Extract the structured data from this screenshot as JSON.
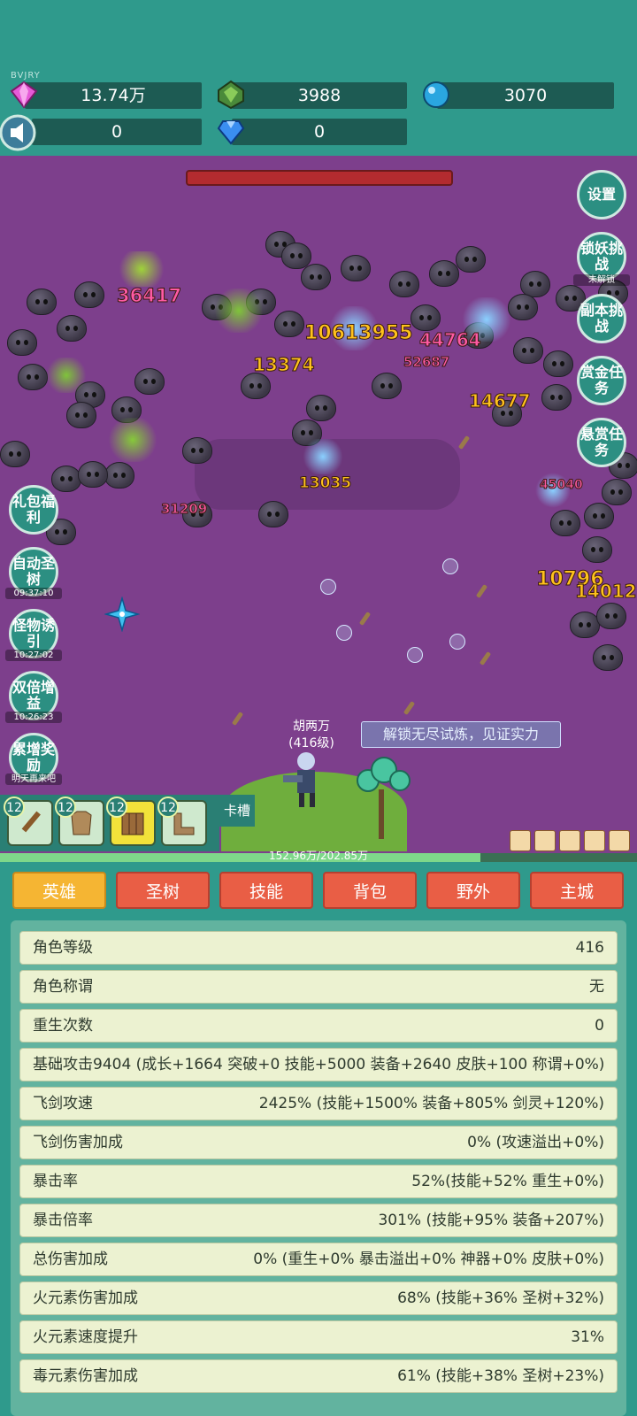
{
  "version_label": "BVJRY",
  "resources": {
    "gems": "13.74万",
    "green_crystal": "3988",
    "blue_orb": "3070",
    "book": "0",
    "diamond": "0"
  },
  "side_buttons_right": [
    {
      "label": "设置",
      "sub": ""
    },
    {
      "label": "锁妖挑战",
      "sub": "未解锁"
    },
    {
      "label": "副本挑战",
      "sub": ""
    },
    {
      "label": "赏金任务",
      "sub": ""
    },
    {
      "label": "悬赏任务",
      "sub": ""
    }
  ],
  "side_buttons_left": [
    {
      "label": "礼包福利",
      "sub": ""
    },
    {
      "label": "自动圣树",
      "sub": "09:37:10"
    },
    {
      "label": "怪物诱引",
      "sub": "10:27:02"
    },
    {
      "label": "双倍增益",
      "sub": "10:26:23"
    },
    {
      "label": "累增奖励",
      "sub": "明天再来吧"
    }
  ],
  "damage_numbers": {
    "big_yellow": [
      "10613955",
      "13374",
      "14677",
      "13035",
      "10796",
      "14012"
    ],
    "big_pink": [
      "36417",
      "44764",
      "52687",
      "45040",
      "31209"
    ]
  },
  "hero": {
    "name": "胡两万",
    "level": "(416级)"
  },
  "quest_banner": "解锁无尽试炼，见证实力",
  "equipment": [
    {
      "level": "12",
      "item": "sword-icon",
      "active": false
    },
    {
      "level": "12",
      "item": "armor-icon",
      "active": false
    },
    {
      "level": "12",
      "item": "shield-icon",
      "active": true
    },
    {
      "level": "12",
      "item": "boots-icon",
      "active": false
    }
  ],
  "card_slot_label": "卡槽",
  "xp": {
    "text": "152.96万/202.85万",
    "fraction": 0.754
  },
  "tabs": [
    "英雄",
    "圣树",
    "技能",
    "背包",
    "野外",
    "主城"
  ],
  "active_tab": "英雄",
  "stats": [
    {
      "k": "角色等级",
      "v": "416"
    },
    {
      "k": "角色称谓",
      "v": "无"
    },
    {
      "k": "重生次数",
      "v": "0"
    },
    {
      "k": "基础攻击9404 (成长+1664 突破+0 技能+5000 装备+2640 皮肤+100 称谓+0%)",
      "v": ""
    },
    {
      "k": "飞剑攻速",
      "v": "2425% (技能+1500% 装备+805% 剑灵+120%)"
    },
    {
      "k": "飞剑伤害加成",
      "v": "0% (攻速溢出+0%)"
    },
    {
      "k": "暴击率",
      "v": "52%(技能+52% 重生+0%)"
    },
    {
      "k": "暴击倍率",
      "v": "301% (技能+95% 装备+207%)"
    },
    {
      "k": "总伤害加成",
      "v": "0% (重生+0% 暴击溢出+0% 神器+0% 皮肤+0%)"
    },
    {
      "k": "火元素伤害加成",
      "v": "68% (技能+36% 圣树+32%)"
    },
    {
      "k": "火元素速度提升",
      "v": "31%"
    },
    {
      "k": "毒元素伤害加成",
      "v": "61% (技能+38% 圣树+23%)"
    }
  ],
  "colors": {
    "teal": "#2f9a8c",
    "battle_bg": "#7d3f8c",
    "tab_red": "#e95e45",
    "tab_active": "#f5b533",
    "row_bg": "#ecf2d1"
  }
}
